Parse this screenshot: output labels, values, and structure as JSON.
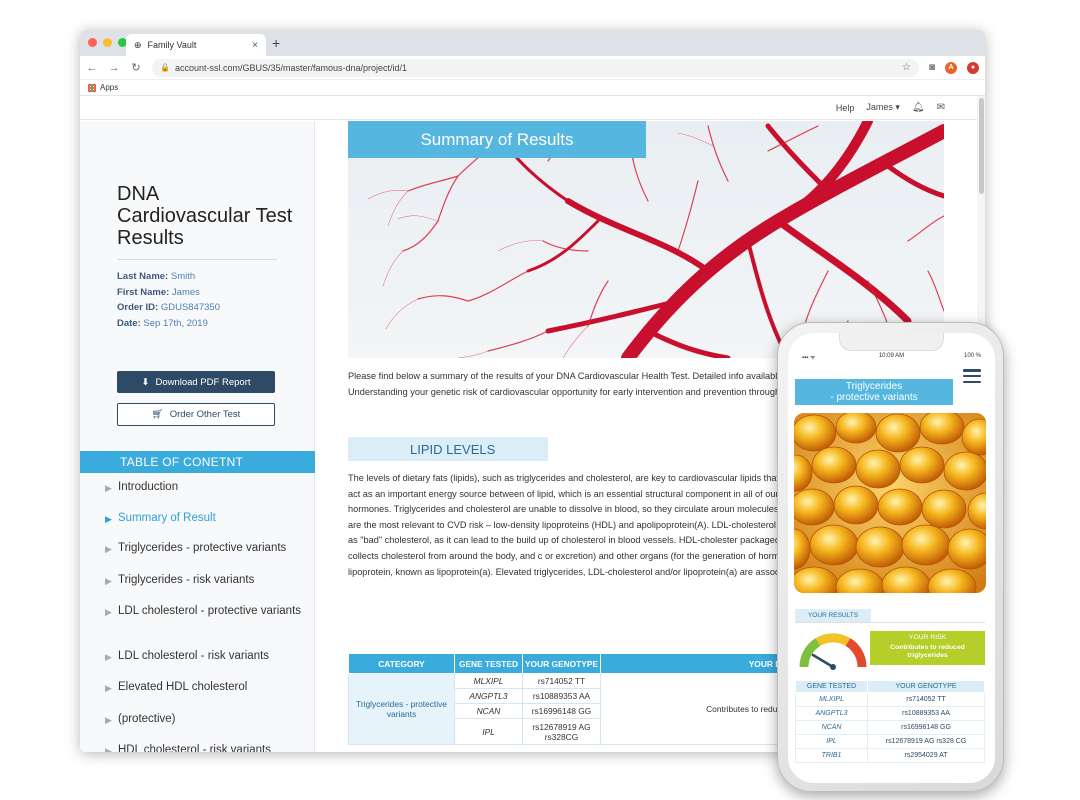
{
  "browser": {
    "tab_title": "Family Vault",
    "url": "account-ssl.com/GBUS/35/master/famous-dna/project/id/1",
    "bookmarks_apps": "Apps",
    "ext_a": "A",
    "ext_b": "●"
  },
  "topnav": {
    "help": "Help",
    "user": "James ▾"
  },
  "sidebar": {
    "title": "DNA Cardiovascular Test Results",
    "last_name_label": "Last Name:",
    "last_name": "Smith",
    "first_name_label": "First Name:",
    "first_name": "James",
    "order_id_label": "Order ID:",
    "order_id": "GDUS847350",
    "date_label": "Date:",
    "date": "Sep 17th, 2019",
    "download_btn": "Download PDF Report",
    "order_btn": "Order Other Test",
    "toc_title": "TABLE OF CONETNT",
    "toc": [
      "Introduction",
      "Summary of Result",
      "Triglycerides - protective variants",
      "Triglycerides - risk variants",
      "LDL cholesterol - protective variants",
      "LDL cholesterol - risk variants",
      "Elevated HDL cholesterol",
      "(protective)",
      "HDL cholesterol - risk variants"
    ]
  },
  "main": {
    "banner": "Summary of Results",
    "intro": "Please find below a summary of the results of your DNA Cardiovascular Health Test. Detailed info available within the main body of this report. Understanding your genetic risk of cardiovascular opportunity for early intervention and prevention through dietary and lifestyle changes.",
    "lipid_heading": "LIPID LEVELS",
    "lipid_text": "The levels of dietary fats (lipids), such as triglycerides and cholesterol, are key to cardiovascular lipids that are an essential part of our diet, as they act as an important energy source between of lipid, which is an essential structural component in all of our cells, and an important molecule hormones. Triglycerides and cholesterol are unable to dissolve in blood, so they circulate aroun molecules called lipoproteins. Three lipoproteins are the most relevant to CVD risk – low-density lipoproteins (HDL) and apolipoprotein(A). LDL-cholesterol refers to the cholesterol that is packag as \"bad\" cholesterol, as it can lead to the build up of cholesterol in blood vessels. HDL-cholester packaged within HDL particles. HDL-cholesterol collects cholesterol from around the body, and c or excretion) and other organs (for the generation of hormones). Apolipoprotein(A) combines w lipoprotein, known as lipoprotein(a). Elevated triglycerides, LDL-cholesterol and/or lipoprotein(a) are associated with poor cardiovascular health.",
    "table_headers": [
      "CATEGORY",
      "GENE TESTED",
      "YOUR GENOTYPE",
      "YOUR RISK"
    ],
    "table_category": "Triglycerides - protective variants",
    "table_rows": [
      {
        "gene": "MLXIPL",
        "genotype": "rs714052 TT"
      },
      {
        "gene": "ANGPTL3",
        "genotype": "rs10889353 AA"
      },
      {
        "gene": "NCAN",
        "genotype": "rs16996148 GG"
      },
      {
        "gene": "IPL",
        "genotype": "rs12678919 AG rs328CG"
      }
    ],
    "table_risk": "Contributes to reduced triglycerides"
  },
  "mobile": {
    "time": "10:09 AM",
    "battery": "100 %",
    "signal": "▪▪▪ ᯤ",
    "banner_line1": "Triglycerides",
    "banner_line2": "- protective variants",
    "results_head": "YOUR RESULTS",
    "risk_title": "YOUR RISK",
    "risk_value": "Contributes to reduced triglycerides",
    "table_headers": [
      "GENE TESTED",
      "YOUR GENOTYPE"
    ],
    "rows": [
      {
        "gene": "MLXIPL",
        "genotype": "rs714052 TT"
      },
      {
        "gene": "ANGPTL3",
        "genotype": "rs10889353 AA"
      },
      {
        "gene": "NCAN",
        "genotype": "rs16996148 GG"
      },
      {
        "gene": "IPL",
        "genotype": "rs12678919 AG rs328 CG"
      },
      {
        "gene": "TRIB1",
        "genotype": "rs2954029 AT"
      }
    ]
  }
}
